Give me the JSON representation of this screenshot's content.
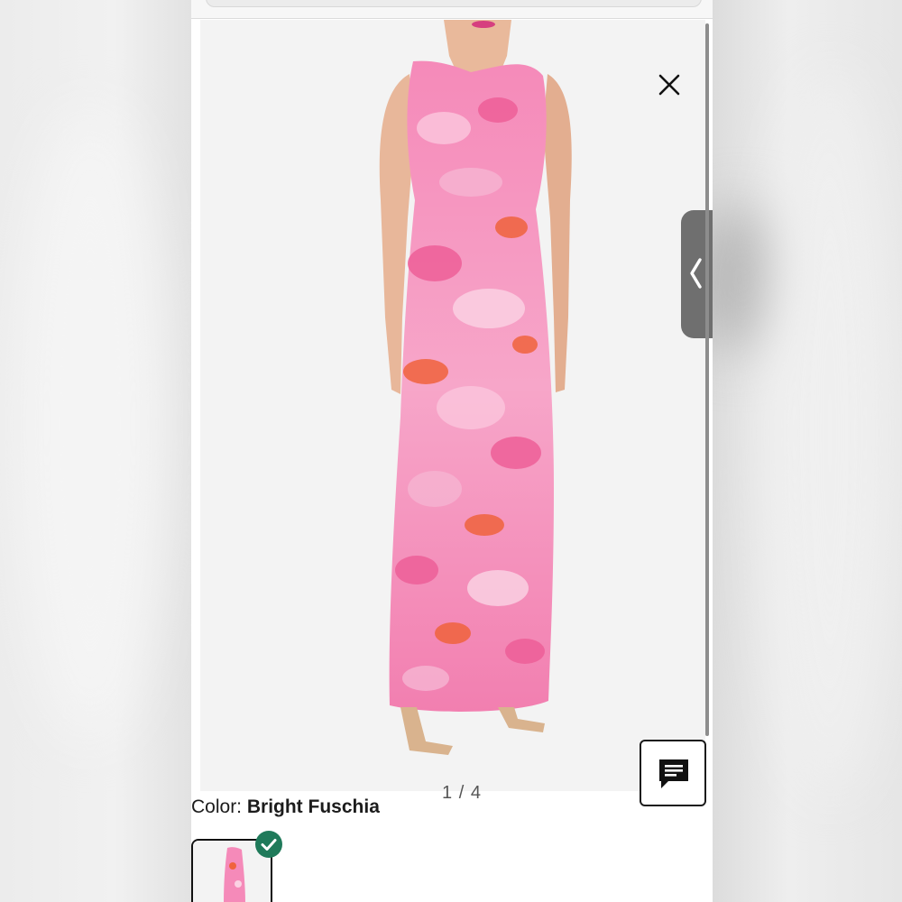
{
  "viewer": {
    "image_alt": "Model wearing pink floral one-shoulder maxi dress",
    "image_counter": "1 / 4",
    "close_icon": "close-icon",
    "collapse_icon": "chevron-left-icon"
  },
  "chat": {
    "icon": "chat-icon"
  },
  "product": {
    "color_label": "Color: ",
    "color_value": "Bright Fuschia",
    "selected_swatch_icon": "checkmark-icon"
  },
  "colors": {
    "accent_green": "#1f7a5a",
    "dress_pink": "#f27fb0",
    "dress_orange": "#f0633d",
    "panel_gray": "#6f6f6f"
  }
}
